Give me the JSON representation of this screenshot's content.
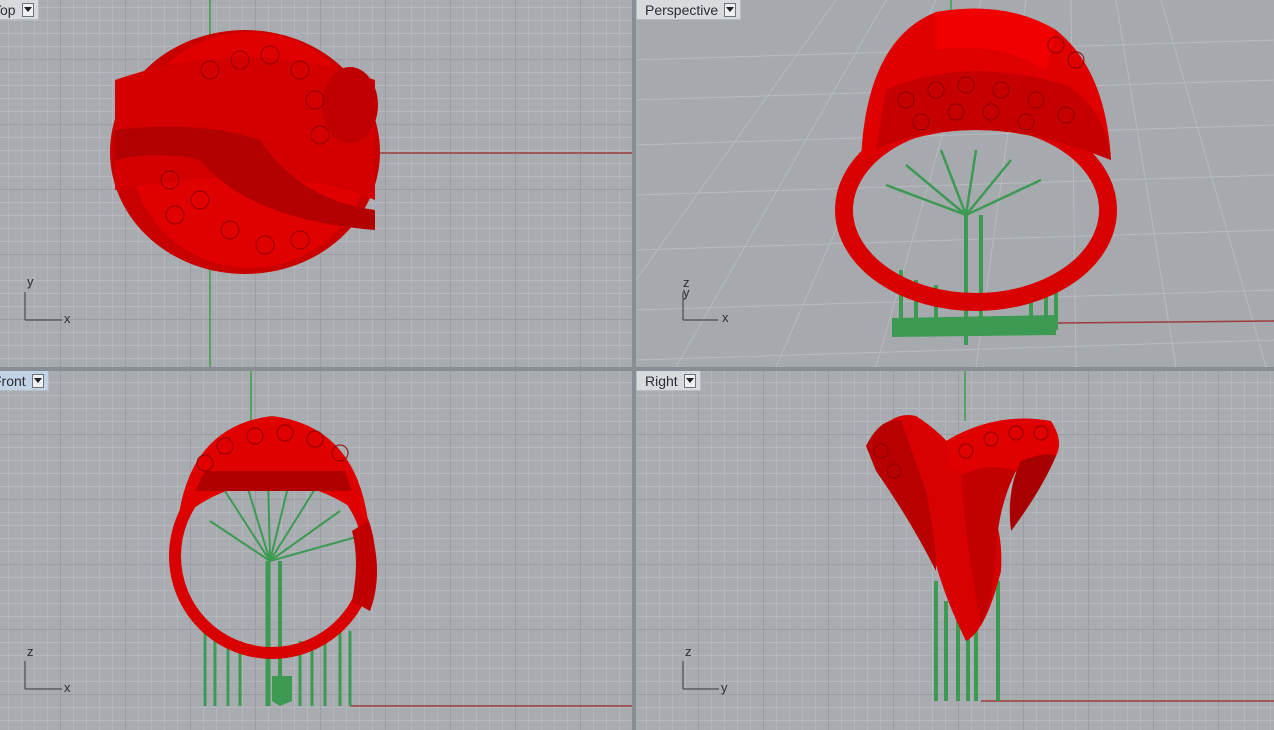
{
  "viewports": {
    "top": {
      "label": "Top",
      "axes": [
        "x",
        "y"
      ]
    },
    "perspective": {
      "label": "Perspective",
      "axes": [
        "x",
        "y",
        "z"
      ]
    },
    "front": {
      "label": "Front",
      "axes": [
        "x",
        "z"
      ]
    },
    "right": {
      "label": "Right",
      "axes": [
        "y",
        "z"
      ]
    }
  },
  "colors": {
    "model": "#e00000",
    "support": "#3c9a52",
    "x_axis": "#9e3b3b",
    "y_axis": "#3f9e4a",
    "active_label": "#c3d3e6"
  },
  "icons": [
    "dropdown-arrow-icon",
    "axis-triad-icon"
  ]
}
